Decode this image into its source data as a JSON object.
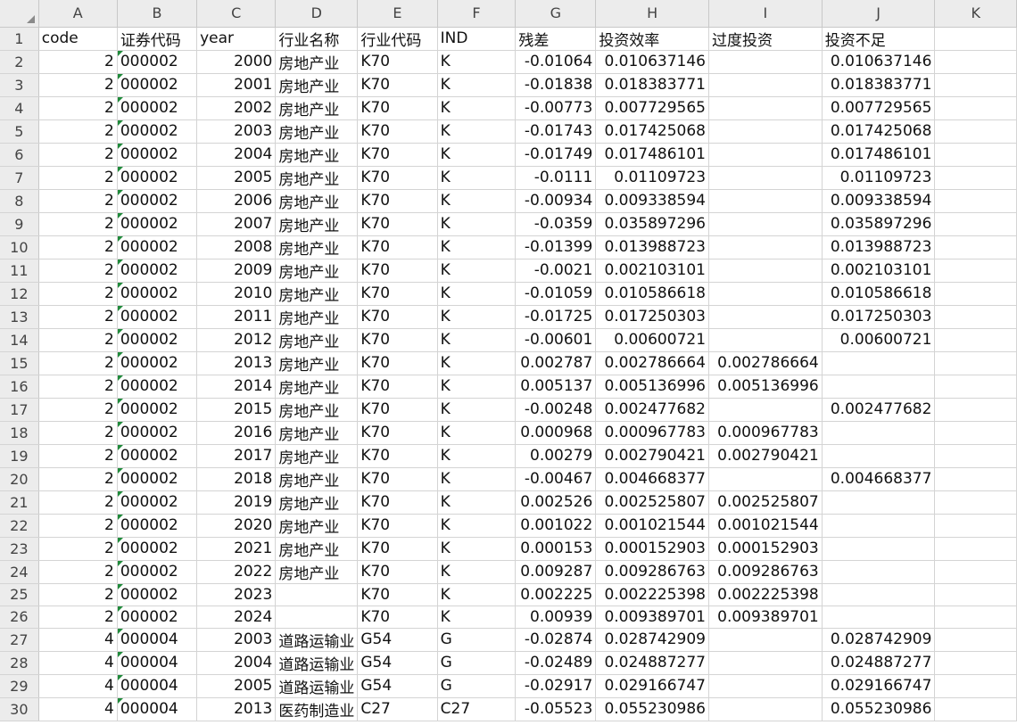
{
  "columns": [
    "A",
    "B",
    "C",
    "D",
    "E",
    "F",
    "G",
    "H",
    "I",
    "J",
    "K"
  ],
  "rows": [
    {
      "n": "1",
      "cells": [
        "code",
        "证券代码",
        "year",
        "行业名称",
        "行业代码",
        "IND",
        "残差",
        "投资效率",
        "过度投资",
        "投资不足",
        ""
      ]
    },
    {
      "n": "2",
      "cells": [
        "2",
        "000002",
        "2000",
        "房地产业",
        "K70",
        "K",
        "-0.01064",
        "0.010637146",
        "",
        "0.010637146",
        ""
      ]
    },
    {
      "n": "3",
      "cells": [
        "2",
        "000002",
        "2001",
        "房地产业",
        "K70",
        "K",
        "-0.01838",
        "0.018383771",
        "",
        "0.018383771",
        ""
      ]
    },
    {
      "n": "4",
      "cells": [
        "2",
        "000002",
        "2002",
        "房地产业",
        "K70",
        "K",
        "-0.00773",
        "0.007729565",
        "",
        "0.007729565",
        ""
      ]
    },
    {
      "n": "5",
      "cells": [
        "2",
        "000002",
        "2003",
        "房地产业",
        "K70",
        "K",
        "-0.01743",
        "0.017425068",
        "",
        "0.017425068",
        ""
      ]
    },
    {
      "n": "6",
      "cells": [
        "2",
        "000002",
        "2004",
        "房地产业",
        "K70",
        "K",
        "-0.01749",
        "0.017486101",
        "",
        "0.017486101",
        ""
      ]
    },
    {
      "n": "7",
      "cells": [
        "2",
        "000002",
        "2005",
        "房地产业",
        "K70",
        "K",
        "-0.0111",
        "0.01109723",
        "",
        "0.01109723",
        ""
      ]
    },
    {
      "n": "8",
      "cells": [
        "2",
        "000002",
        "2006",
        "房地产业",
        "K70",
        "K",
        "-0.00934",
        "0.009338594",
        "",
        "0.009338594",
        ""
      ]
    },
    {
      "n": "9",
      "cells": [
        "2",
        "000002",
        "2007",
        "房地产业",
        "K70",
        "K",
        "-0.0359",
        "0.035897296",
        "",
        "0.035897296",
        ""
      ]
    },
    {
      "n": "10",
      "cells": [
        "2",
        "000002",
        "2008",
        "房地产业",
        "K70",
        "K",
        "-0.01399",
        "0.013988723",
        "",
        "0.013988723",
        ""
      ]
    },
    {
      "n": "11",
      "cells": [
        "2",
        "000002",
        "2009",
        "房地产业",
        "K70",
        "K",
        "-0.0021",
        "0.002103101",
        "",
        "0.002103101",
        ""
      ]
    },
    {
      "n": "12",
      "cells": [
        "2",
        "000002",
        "2010",
        "房地产业",
        "K70",
        "K",
        "-0.01059",
        "0.010586618",
        "",
        "0.010586618",
        ""
      ]
    },
    {
      "n": "13",
      "cells": [
        "2",
        "000002",
        "2011",
        "房地产业",
        "K70",
        "K",
        "-0.01725",
        "0.017250303",
        "",
        "0.017250303",
        ""
      ]
    },
    {
      "n": "14",
      "cells": [
        "2",
        "000002",
        "2012",
        "房地产业",
        "K70",
        "K",
        "-0.00601",
        "0.00600721",
        "",
        "0.00600721",
        ""
      ]
    },
    {
      "n": "15",
      "cells": [
        "2",
        "000002",
        "2013",
        "房地产业",
        "K70",
        "K",
        "0.002787",
        "0.002786664",
        "0.002786664",
        "",
        ""
      ]
    },
    {
      "n": "16",
      "cells": [
        "2",
        "000002",
        "2014",
        "房地产业",
        "K70",
        "K",
        "0.005137",
        "0.005136996",
        "0.005136996",
        "",
        ""
      ]
    },
    {
      "n": "17",
      "cells": [
        "2",
        "000002",
        "2015",
        "房地产业",
        "K70",
        "K",
        "-0.00248",
        "0.002477682",
        "",
        "0.002477682",
        ""
      ]
    },
    {
      "n": "18",
      "cells": [
        "2",
        "000002",
        "2016",
        "房地产业",
        "K70",
        "K",
        "0.000968",
        "0.000967783",
        "0.000967783",
        "",
        ""
      ]
    },
    {
      "n": "19",
      "cells": [
        "2",
        "000002",
        "2017",
        "房地产业",
        "K70",
        "K",
        "0.00279",
        "0.002790421",
        "0.002790421",
        "",
        ""
      ]
    },
    {
      "n": "20",
      "cells": [
        "2",
        "000002",
        "2018",
        "房地产业",
        "K70",
        "K",
        "-0.00467",
        "0.004668377",
        "",
        "0.004668377",
        ""
      ]
    },
    {
      "n": "21",
      "cells": [
        "2",
        "000002",
        "2019",
        "房地产业",
        "K70",
        "K",
        "0.002526",
        "0.002525807",
        "0.002525807",
        "",
        ""
      ]
    },
    {
      "n": "22",
      "cells": [
        "2",
        "000002",
        "2020",
        "房地产业",
        "K70",
        "K",
        "0.001022",
        "0.001021544",
        "0.001021544",
        "",
        ""
      ]
    },
    {
      "n": "23",
      "cells": [
        "2",
        "000002",
        "2021",
        "房地产业",
        "K70",
        "K",
        "0.000153",
        "0.000152903",
        "0.000152903",
        "",
        ""
      ]
    },
    {
      "n": "24",
      "cells": [
        "2",
        "000002",
        "2022",
        "房地产业",
        "K70",
        "K",
        "0.009287",
        "0.009286763",
        "0.009286763",
        "",
        ""
      ]
    },
    {
      "n": "25",
      "cells": [
        "2",
        "000002",
        "2023",
        "",
        "K70",
        "K",
        "0.002225",
        "0.002225398",
        "0.002225398",
        "",
        ""
      ]
    },
    {
      "n": "26",
      "cells": [
        "2",
        "000002",
        "2024",
        "",
        "K70",
        "K",
        "0.00939",
        "0.009389701",
        "0.009389701",
        "",
        ""
      ]
    },
    {
      "n": "27",
      "cells": [
        "4",
        "000004",
        "2003",
        "道路运输业",
        "G54",
        "G",
        "-0.02874",
        "0.028742909",
        "",
        "0.028742909",
        ""
      ]
    },
    {
      "n": "28",
      "cells": [
        "4",
        "000004",
        "2004",
        "道路运输业",
        "G54",
        "G",
        "-0.02489",
        "0.024887277",
        "",
        "0.024887277",
        ""
      ]
    },
    {
      "n": "29",
      "cells": [
        "4",
        "000004",
        "2005",
        "道路运输业",
        "G54",
        "G",
        "-0.02917",
        "0.029166747",
        "",
        "0.029166747",
        ""
      ]
    },
    {
      "n": "30",
      "cells": [
        "4",
        "000004",
        "2013",
        "医药制造业",
        "C27",
        "C27",
        "-0.05523",
        "0.055230986",
        "",
        "0.055230986",
        ""
      ]
    }
  ]
}
